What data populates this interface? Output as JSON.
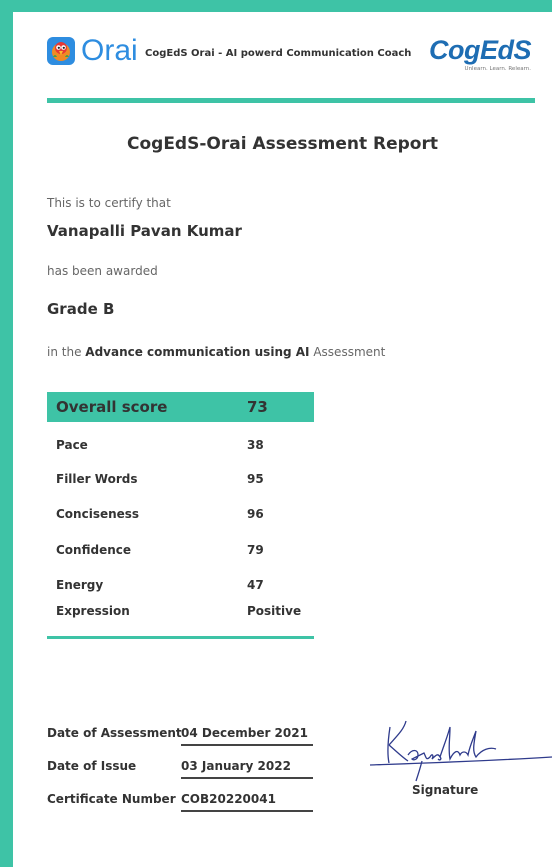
{
  "header": {
    "orai_brand": "Orai",
    "tagline": "CogEdS Orai - AI powerd Communication Coach",
    "cog_brand": "CogEdS",
    "cog_motto": "Unlearn. Learn. Relearn.",
    "accent_color": "#3ec3a6",
    "brand_blue": "#2e8de0"
  },
  "report": {
    "title": "CogEdS-Orai Assessment Report",
    "certify_text": "This is to certify that",
    "name": "Vanapalli Pavan Kumar",
    "awarded_text": "has been awarded",
    "grade": "Grade B",
    "assessment_prefix": "in the",
    "assessment_name": "Advance communication using AI",
    "assessment_suffix": "Assessment"
  },
  "scores": {
    "overall_label": "Overall score",
    "overall_value": "73",
    "rows": [
      {
        "label": "Pace",
        "value": "38"
      },
      {
        "label": "Filler Words",
        "value": "95"
      },
      {
        "label": "Conciseness",
        "value": "96"
      },
      {
        "label": "Confidence",
        "value": "79"
      },
      {
        "label": "Energy",
        "value": "47"
      },
      {
        "label": "Expression",
        "value": "Positive"
      }
    ]
  },
  "details": {
    "date_of_assessment_label": "Date of Assessment",
    "date_of_assessment": "04 December 2021",
    "date_of_issue_label": "Date of Issue",
    "date_of_issue": "03 January 2022",
    "certificate_number_label": "Certificate Number",
    "certificate_number": "COB20220041"
  },
  "signature": {
    "label": "Signature",
    "handwritten": "Kaushik"
  }
}
